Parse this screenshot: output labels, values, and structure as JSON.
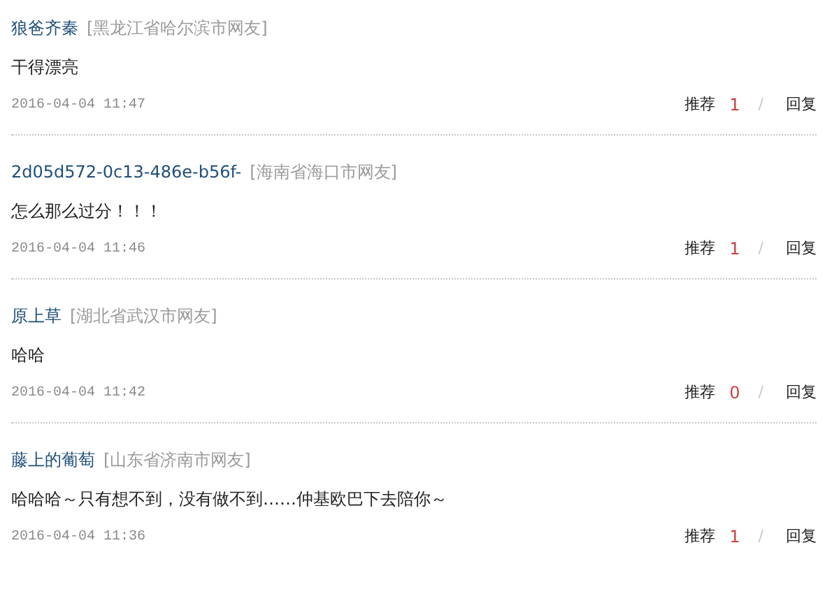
{
  "comments": [
    {
      "user": "狼爸齐秦",
      "location": "[黑龙江省哈尔滨市网友]",
      "text": "干得漂亮",
      "time": "2016-04-04 11:47",
      "recommend_label": "推荐",
      "recommend_count": "1",
      "separator": "/",
      "reply_label": "回复"
    },
    {
      "user": "2d05d572-0c13-486e-b56f-",
      "location": "[海南省海口市网友]",
      "text": "怎么那么过分！！！",
      "time": "2016-04-04 11:46",
      "recommend_label": "推荐",
      "recommend_count": "1",
      "separator": "/",
      "reply_label": "回复"
    },
    {
      "user": "原上草",
      "location": "[湖北省武汉市网友]",
      "text": "哈哈",
      "time": "2016-04-04 11:42",
      "recommend_label": "推荐",
      "recommend_count": "0",
      "separator": "/",
      "reply_label": "回复"
    },
    {
      "user": "藤上的葡萄",
      "location": "[山东省济南市网友]",
      "text": "哈哈哈～只有想不到，没有做不到……仲基欧巴下去陪你～",
      "time": "2016-04-04 11:36",
      "recommend_label": "推荐",
      "recommend_count": "1",
      "separator": "/",
      "reply_label": "回复"
    }
  ]
}
